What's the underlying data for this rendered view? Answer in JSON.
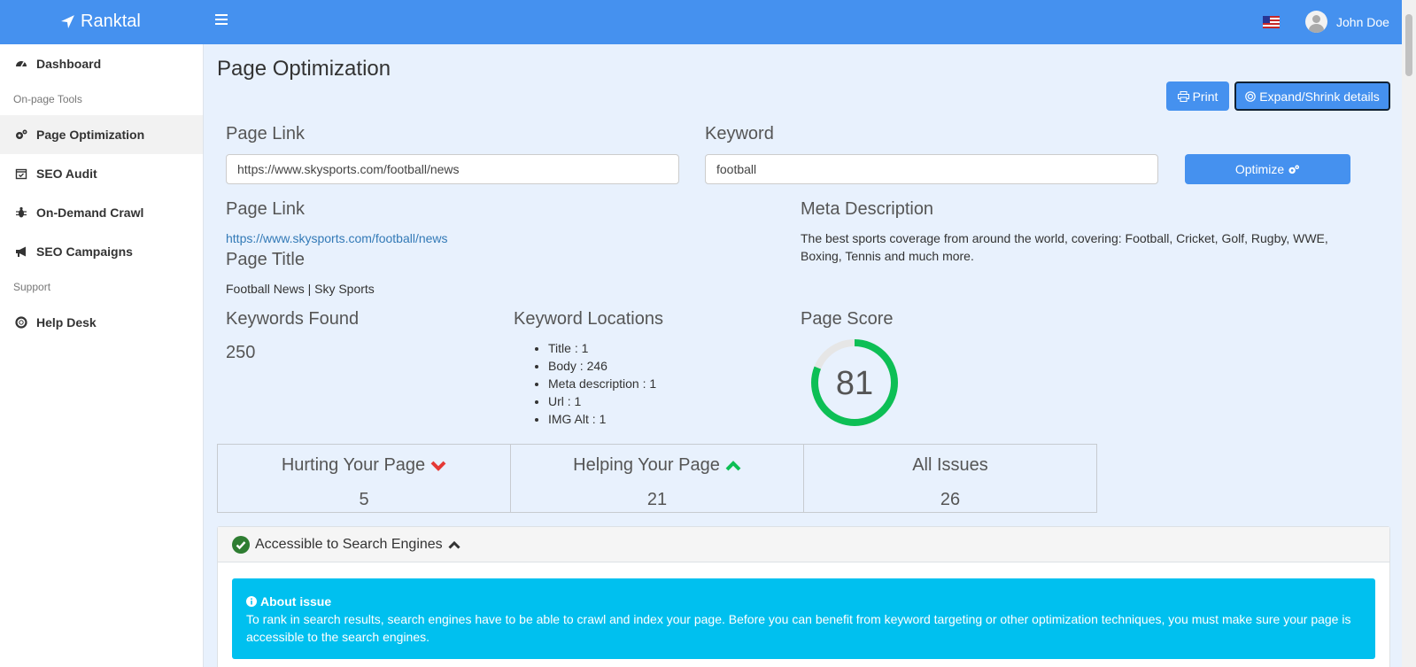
{
  "app": {
    "brand": "Ranktal"
  },
  "header": {
    "user_name": "John Doe"
  },
  "sidebar": {
    "items": [
      {
        "label": "Dashboard",
        "icon": "tachometer-icon"
      },
      {
        "section": "On-page Tools"
      },
      {
        "label": "Page Optimization",
        "icon": "cogs-icon",
        "active": true
      },
      {
        "label": "SEO Audit",
        "icon": "calendar-check-icon"
      },
      {
        "label": "On-Demand Crawl",
        "icon": "bug-icon"
      },
      {
        "label": "SEO Campaigns",
        "icon": "bullhorn-icon"
      },
      {
        "section": "Support"
      },
      {
        "label": "Help Desk",
        "icon": "life-ring-icon"
      }
    ]
  },
  "main": {
    "title": "Page Optimization",
    "print_label": "Print",
    "expand_label": "Expand/Shrink details",
    "form": {
      "page_link_label": "Page Link",
      "page_link_value": "https://www.skysports.com/football/news",
      "keyword_label": "Keyword",
      "keyword_value": "football",
      "optimize_label": "Optimize"
    },
    "details": {
      "page_link_label": "Page Link",
      "page_link": "https://www.skysports.com/football/news",
      "page_title_label": "Page Title",
      "page_title": "Football News | Sky Sports",
      "meta_label": "Meta Description",
      "meta": "The best sports coverage from around the world, covering: Football, Cricket, Golf, Rugby, WWE, Boxing, Tennis and much more."
    },
    "keywords_found_label": "Keywords Found",
    "keywords_found": "250",
    "locations_label": "Keyword Locations",
    "locations": [
      "Title : 1",
      "Body : 246",
      "Meta description : 1",
      "Url : 1",
      "IMG Alt : 1"
    ],
    "score_label": "Page Score",
    "score": 81,
    "score_display": "81",
    "stats": {
      "hurting_label": "Hurting Your Page",
      "hurting": "5",
      "helping_label": "Helping Your Page",
      "helping": "21",
      "all_label": "All Issues",
      "all": "26"
    },
    "panel": {
      "title": "Accessible to Search Engines",
      "about_title": "About issue",
      "about_text": "To rank in search results, search engines have to be able to crawl and index your page. Before you can benefit from keyword targeting or other optimization techniques, you must make sure your page is accessible to the search engines."
    }
  },
  "colors": {
    "primary": "#4591ef",
    "success": "#0dbf55",
    "danger": "#e53935",
    "info": "#00c0ef"
  }
}
